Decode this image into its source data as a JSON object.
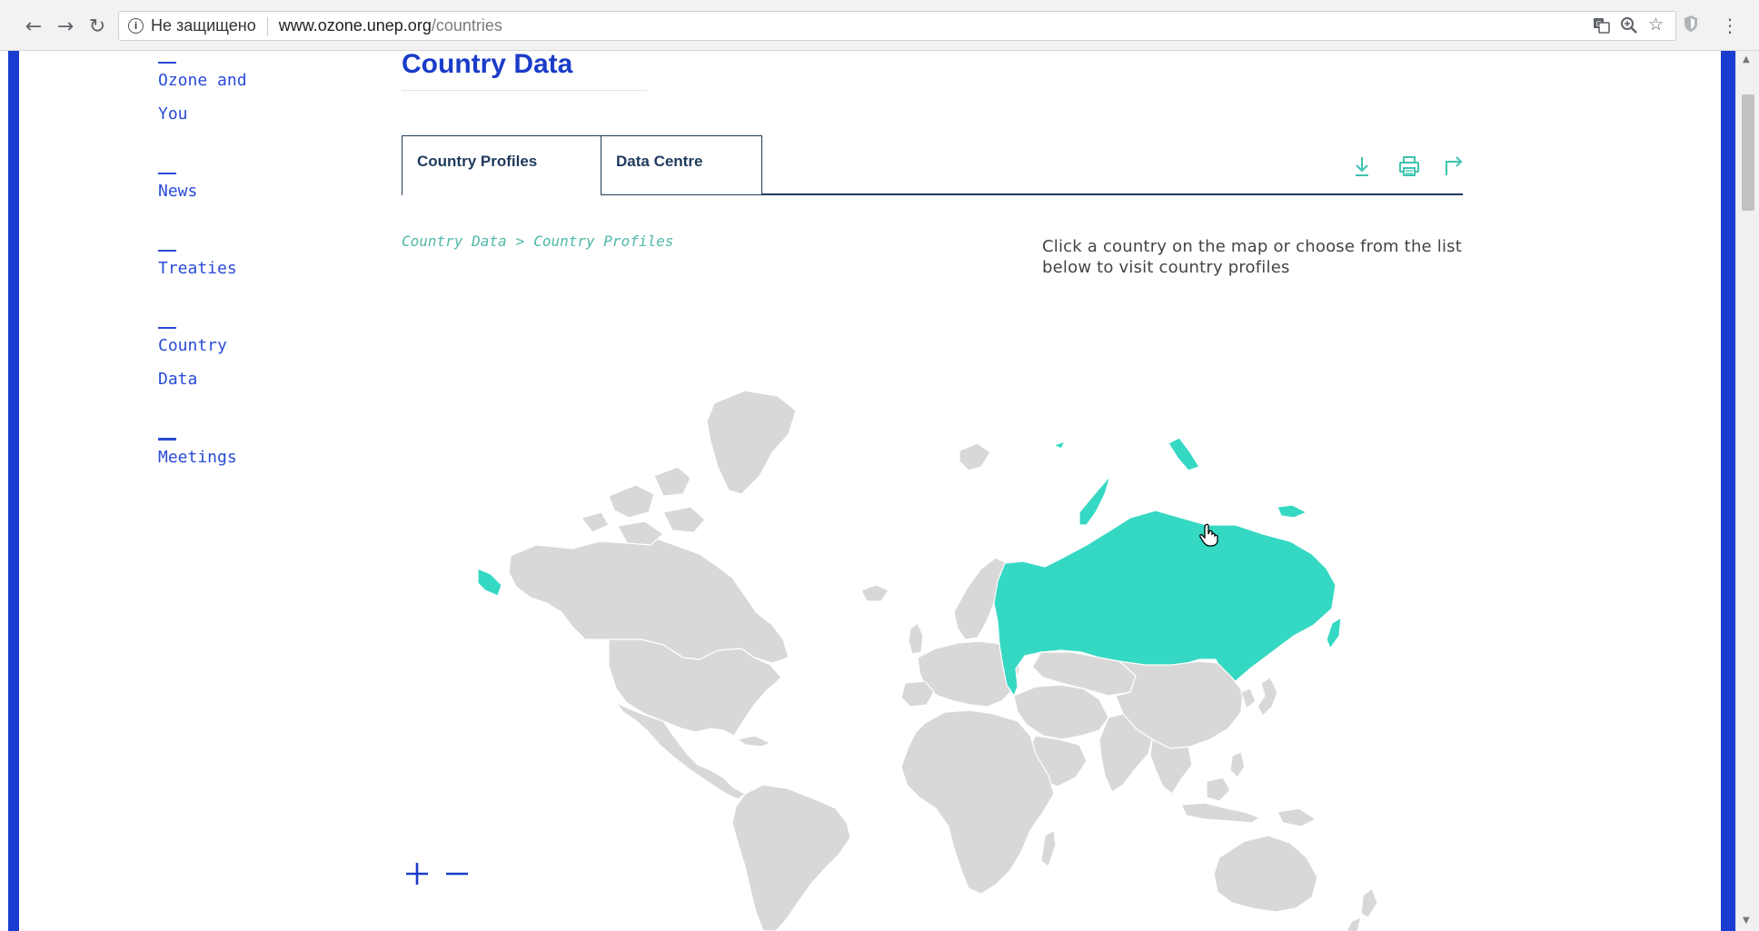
{
  "browser": {
    "security_label": "Не защищено",
    "url_host": "www.ozone.unep.org",
    "url_path": "/countries"
  },
  "sidebar": {
    "items": [
      {
        "label": "Ozone and You"
      },
      {
        "label": "News"
      },
      {
        "label": "Treaties"
      },
      {
        "label": "Country Data"
      },
      {
        "label": "Meetings"
      }
    ]
  },
  "page": {
    "title": "Country Data",
    "tabs": [
      {
        "label": "Country Profiles",
        "active": true
      },
      {
        "label": "Data Centre",
        "active": false
      }
    ],
    "breadcrumb": {
      "items": [
        "Country Data",
        "Country Profiles"
      ],
      "separator": ">"
    },
    "instructions": "Click a country on the map or choose from the list below to visit country profiles"
  },
  "map": {
    "highlighted_country": "Russia",
    "land_color": "#d8d8d8",
    "highlight_color": "#35d8c3"
  },
  "colors": {
    "accent_blue": "#1a3cd0",
    "teal": "#35d8c3",
    "tab_navy": "#1f3a5c"
  },
  "icons": {
    "back": "arrow-left-icon",
    "forward": "arrow-right-icon",
    "reload": "reload-icon",
    "download": "download-icon",
    "print": "print-icon",
    "share": "share-icon",
    "zoom_in": "plus-icon",
    "zoom_out": "minus-icon"
  }
}
